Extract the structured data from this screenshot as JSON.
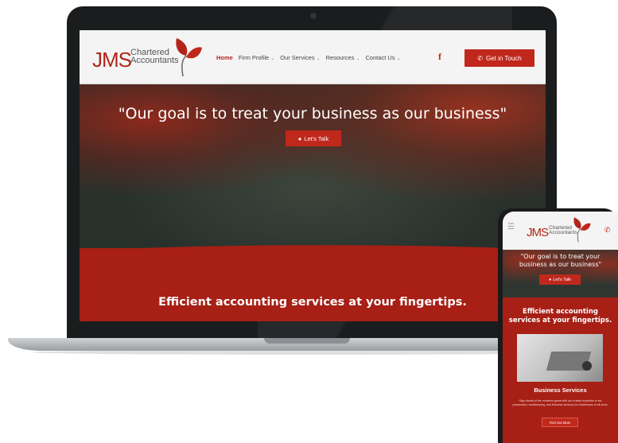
{
  "brand": {
    "mark": "JMS",
    "name_line1": "Chartered",
    "name_line2": "Accountants"
  },
  "nav": {
    "items": [
      {
        "label": "Home",
        "active": true,
        "dropdown": false
      },
      {
        "label": "Firm Profile",
        "active": false,
        "dropdown": true
      },
      {
        "label": "Our Services",
        "active": false,
        "dropdown": true
      },
      {
        "label": "Resources",
        "active": false,
        "dropdown": true
      },
      {
        "label": "Contact Us",
        "active": false,
        "dropdown": true
      }
    ],
    "social_icon": "facebook-icon",
    "social_glyph": "f",
    "cta_label": "Get in Touch",
    "cta_icon": "phone-icon"
  },
  "hero": {
    "quote": "\"Our goal is to treat your business as our business\"",
    "button_label": "Let's Talk",
    "button_icon": "chat-icon"
  },
  "band": {
    "heading": "Efficient accounting services at your fingertips."
  },
  "mobile": {
    "menu_icon": "hamburger-icon",
    "call_icon": "phone-icon",
    "quote": "\"Our goal is to treat your business as our business\"",
    "button_label": "Let's Talk",
    "heading": "Efficient accounting services at your fingertips.",
    "services_title": "Business Services",
    "services_text": "Stay ahead of the numbers game with our trusted expertise in tax preparation, bookkeeping, and financial advisory for businesses of all sizes.",
    "services_button": "Find Out More"
  },
  "colors": {
    "brand_red": "#c0281c",
    "band_red": "#a71f15",
    "header_bg": "#f4f4f4"
  }
}
